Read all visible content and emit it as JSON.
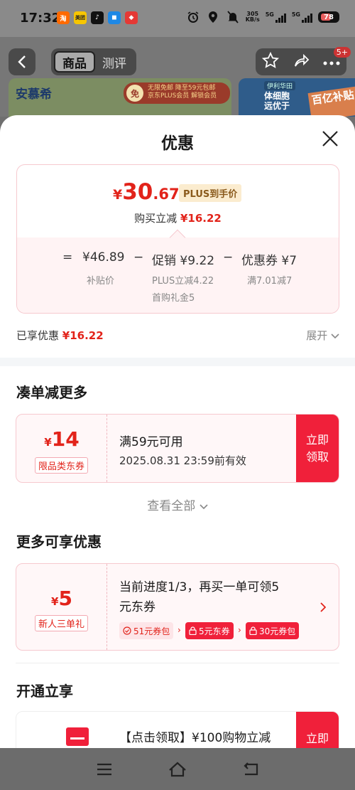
{
  "status_bar": {
    "time": "17:32",
    "apps": [
      {
        "name": "taobao-icon",
        "label": "淘",
        "color": "#ff6a00"
      },
      {
        "name": "meituan-icon",
        "label": "美团",
        "color": "#f7c600"
      },
      {
        "name": "tiktok-icon",
        "label": "♪",
        "color": "#111111"
      },
      {
        "name": "app-blue-icon",
        "label": "◼",
        "color": "#1e88e5"
      },
      {
        "name": "app-red-icon",
        "label": "◆",
        "color": "#e53935"
      }
    ],
    "net_speed": "305",
    "net_unit": "KB/s",
    "signal1": "5G",
    "signal2": "5G",
    "battery": "78"
  },
  "header": {
    "tabs": [
      {
        "label": "商品",
        "active": true
      },
      {
        "label": "测评",
        "active": false
      }
    ],
    "badge": "5+",
    "banner_left": {
      "brand": "安慕希",
      "free_mark": "免",
      "promo_line1": "无限免邮",
      "promo_line2": "降至59元包邮",
      "promo_line3": "京东PLUS会员",
      "promo_line4": "解锁会员"
    },
    "banner_right": {
      "tag": "伊利华田",
      "line1": "体细胞",
      "line2": "远优于",
      "big": "百亿补贴"
    }
  },
  "sheet": {
    "title": "优惠",
    "price_card": {
      "currency": "¥",
      "price_int": "30",
      "price_dec": ".67",
      "plus_tag": "PLUS到手价",
      "reduce_label": "购买立减",
      "reduce_value": "¥16.22",
      "formula": {
        "eq": "=",
        "subsidy_price": "¥46.89",
        "minus1": "−",
        "promo": "促销 ¥9.22",
        "minus2": "−",
        "coupon": "优惠券 ¥7"
      },
      "subsidy_label": "补贴价",
      "promo_detail1": "PLUS立减4.22",
      "promo_detail2": "首购礼金5",
      "coupon_detail": "满7.01减7"
    },
    "enjoyed_label": "已享优惠",
    "enjoyed_value": "¥16.22",
    "expand_label": "展开",
    "section1": {
      "title": "凑单减更多",
      "coupon": {
        "currency": "¥",
        "amount": "14",
        "tag": "限品类东券",
        "condition": "满59元可用",
        "validity": "2025.08.31 23:59前有效",
        "claim_line1": "立即",
        "claim_line2": "领取"
      },
      "view_all": "查看全部"
    },
    "section2": {
      "title": "更多可享优惠",
      "coupon": {
        "currency": "¥",
        "amount": "5",
        "tag": "新人三单礼",
        "desc_line1": "当前进度1/3，再买一单可领5",
        "desc_line2": "元东券",
        "chips": [
          "51元券包",
          "5元东券",
          "30元券包"
        ]
      }
    },
    "section3": {
      "title": "开通立享",
      "item_text": "【点击领取】¥100购物立减",
      "claim_line1": "立即"
    }
  },
  "colors": {
    "accent_red": "#e2231a",
    "claim_red": "#f0203a",
    "plus_gold": "#8a5a1c"
  }
}
